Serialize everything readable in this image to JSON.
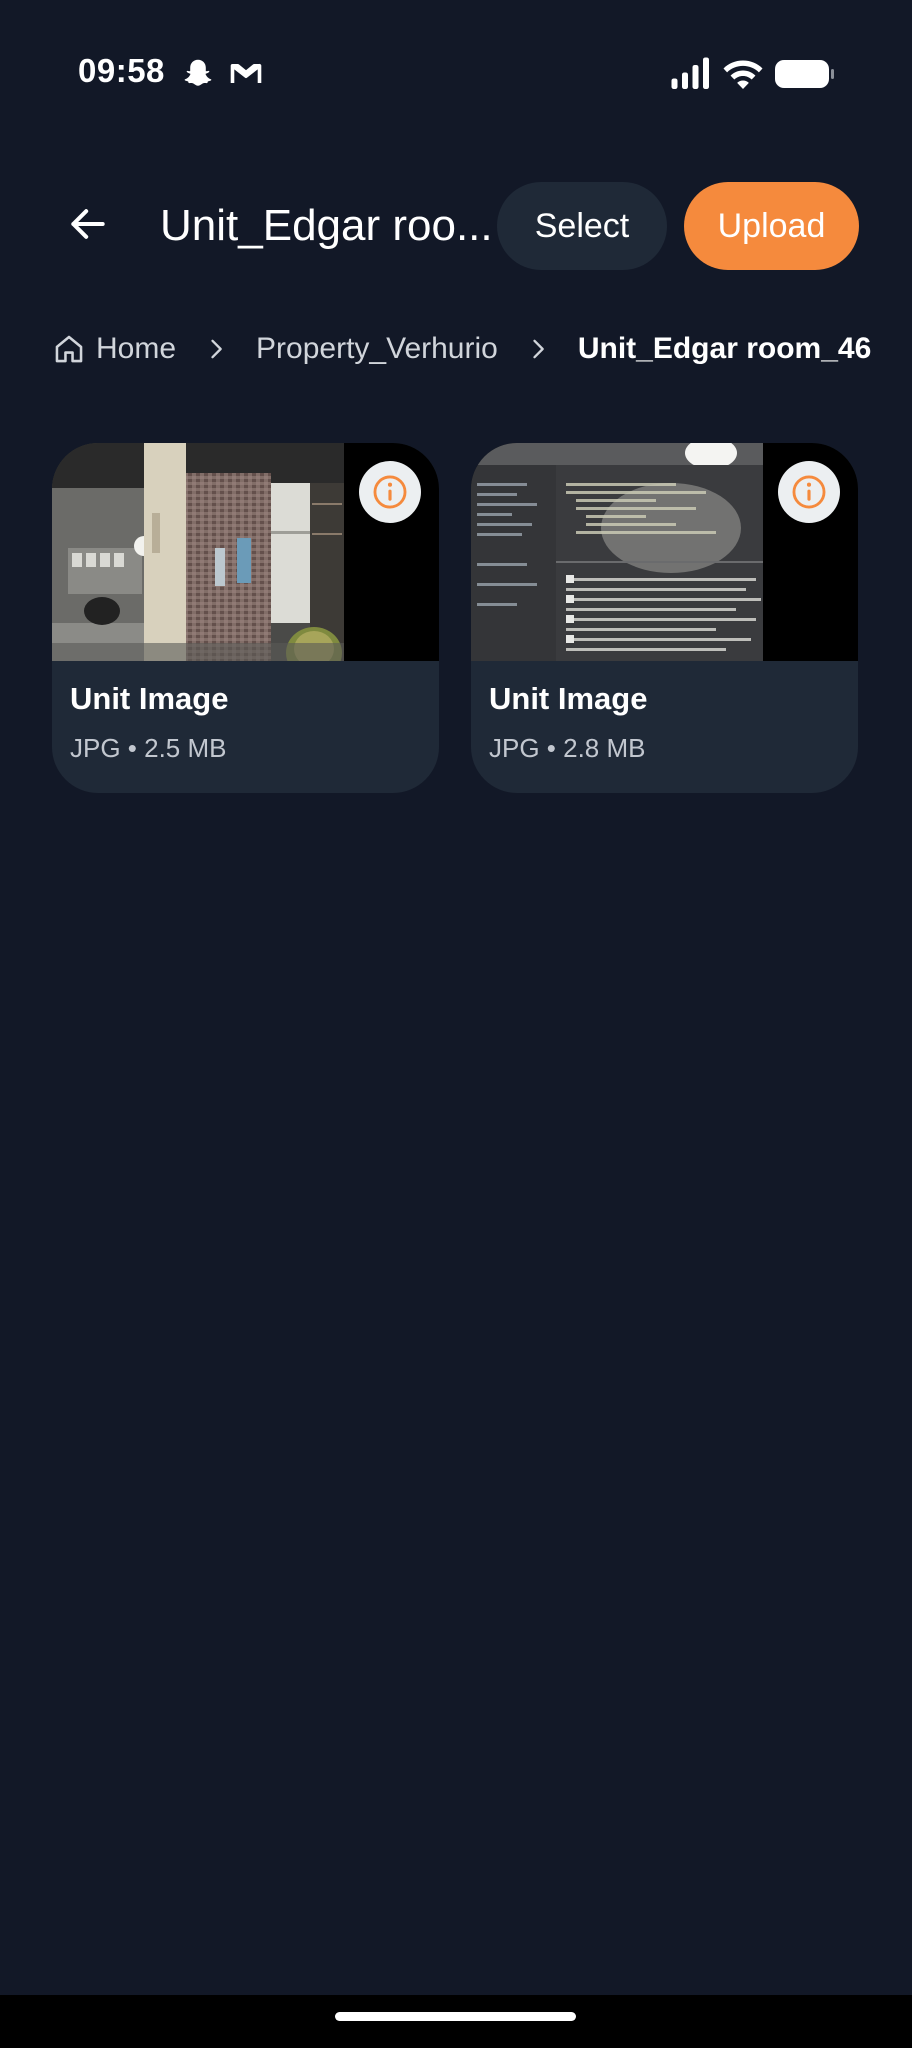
{
  "status_bar": {
    "time": "09:58",
    "icons": [
      "snapchat-icon",
      "gmail-icon",
      "signal-icon",
      "wifi-icon",
      "battery-icon"
    ]
  },
  "header": {
    "title": "Unit_Edgar roo...",
    "select_label": "Select",
    "upload_label": "Upload"
  },
  "breadcrumb": {
    "items": [
      "Home",
      "Property_Verhurio",
      "Unit_Edgar room_46"
    ]
  },
  "files": [
    {
      "title": "Unit Image",
      "meta": "JPG • 2.5 MB",
      "thumb": "room-photo"
    },
    {
      "title": "Unit Image",
      "meta": "JPG • 2.8 MB",
      "thumb": "code-screen-photo"
    }
  ],
  "colors": {
    "background": "#121827",
    "card": "#1f2937",
    "accent": "#f58a3d"
  }
}
